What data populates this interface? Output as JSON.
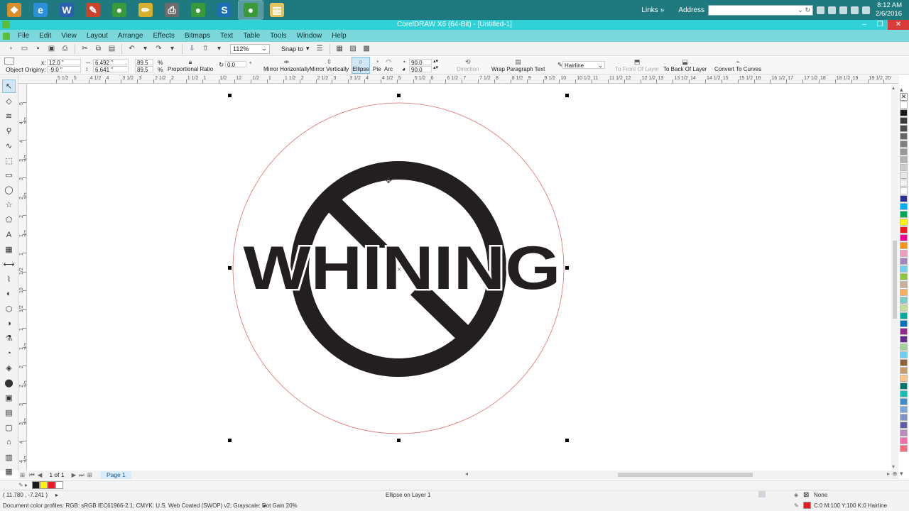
{
  "taskbar": {
    "apps": [
      {
        "name": "start",
        "glyph": "❖",
        "color": "#d98e2b"
      },
      {
        "name": "internet-explorer",
        "glyph": "e",
        "color": "#2b8fd9"
      },
      {
        "name": "word",
        "glyph": "W",
        "color": "#2b5fb0"
      },
      {
        "name": "coreldraw-graphics",
        "glyph": "✎",
        "color": "#c8452c"
      },
      {
        "name": "corel-app",
        "glyph": "●",
        "color": "#3a9a3a"
      },
      {
        "name": "corel-paint",
        "glyph": "✏",
        "color": "#d9b02b"
      },
      {
        "name": "printer",
        "glyph": "⎙",
        "color": "#6b6b6b"
      },
      {
        "name": "corel-app-2",
        "glyph": "●",
        "color": "#3a9a3a"
      },
      {
        "name": "s-app",
        "glyph": "S",
        "color": "#1b6fb5"
      },
      {
        "name": "coreldraw-active",
        "glyph": "●",
        "color": "#3a9a3a"
      },
      {
        "name": "file-explorer",
        "glyph": "▤",
        "color": "#e8c35a"
      }
    ],
    "links_label": "Links",
    "links_chevron": "»",
    "address_label": "Address",
    "address_value": "",
    "clock_time": "8:12 AM",
    "clock_date": "2/6/2016"
  },
  "window": {
    "title": "CorelDRAW X6 (64-Bit) - [Untitled-1]",
    "minimize": "–",
    "restore": "❐",
    "close": "✕"
  },
  "menu": [
    "File",
    "Edit",
    "View",
    "Layout",
    "Arrange",
    "Effects",
    "Bitmaps",
    "Text",
    "Table",
    "Tools",
    "Window",
    "Help"
  ],
  "std_toolbar": {
    "icons": [
      "new-icon",
      "open-icon",
      "save-icon",
      "save-all-icon",
      "print-icon",
      "cut-icon",
      "copy-icon",
      "paste-icon",
      "undo-icon",
      "redo-icon",
      "import-icon",
      "export-icon"
    ],
    "zoom": "112%",
    "snap_to": "Snap to"
  },
  "property_bar": {
    "object_origin": "Object Origin",
    "x_label": "x:",
    "x": "12.0 \"",
    "y_label": "y:",
    "y": "-9.0 \"",
    "w": "6.492 \"",
    "h": "6.641 \"",
    "scale_x": "89.5",
    "scale_y": "89.5",
    "percent": "%",
    "proportional_ratio": "Proportional Ratio",
    "rotation": "0.0",
    "degree": "°",
    "mirror_h": "Mirror Horizontally",
    "mirror_v": "Mirror Vertically",
    "ellipse": "Ellipse",
    "pie": "Pie",
    "arc": "Arc",
    "start_angle": "90.0",
    "end_angle": "90.0",
    "direction": "Direction",
    "wrap_text": "Wrap Paragraph Text",
    "outline": "Hairline",
    "to_front_of_layer": "To Front Of Layer",
    "to_back_of_layer": "To Back Of Layer",
    "convert_to_curves": "Convert To Curves"
  },
  "ruler": {
    "h_labels": [
      "5 1/2",
      "5",
      "4 1/2",
      "4",
      "3 1/2",
      "3",
      "2 1/2",
      "2",
      "1 1/2",
      "1",
      "1/2",
      "12",
      "1/2",
      "1",
      "1 1/2",
      "2",
      "2 1/2",
      "3",
      "3 1/2",
      "4",
      "4 1/2",
      "5",
      "5 1/2",
      "6",
      "6 1/2",
      "7",
      "7 1/2",
      "8",
      "8 1/2",
      "9",
      "9 1/2",
      "10",
      "10 1/2",
      "11",
      "11 1/2",
      "12",
      "12 1/2",
      "13",
      "13 1/2",
      "14",
      "14 1/2",
      "15",
      "15 1/2",
      "16",
      "16 1/2",
      "17",
      "17 1/2",
      "18",
      "18 1/2",
      "19",
      "19 1/2",
      "20",
      "20 1/2",
      "21",
      "21 1/2"
    ],
    "v_labels": [
      "5",
      "4 1/2",
      "4",
      "3 1/2",
      "3",
      "2 1/2",
      "2",
      "1 1/2",
      "1",
      "1/2",
      "10",
      "1/2",
      "1",
      "1 1/2",
      "2",
      "2 1/2",
      "3",
      "3 1/2",
      "4",
      "4 1/2",
      "5"
    ]
  },
  "toolbox": [
    "pick-tool-icon",
    "shape-tool-icon",
    "smear-tool-icon",
    "zoom-tool-icon",
    "freehand-tool-icon",
    "smart-fill-icon",
    "rectangle-tool-icon",
    "ellipse-tool-icon",
    "polygon-tool-icon",
    "basic-shapes-icon",
    "text-tool-icon",
    "table-tool-icon",
    "dimension-tool-icon",
    "connector-tool-icon",
    "blend-tool-icon",
    "extrude-tool-icon",
    "transparency-tool-icon",
    "eyedropper-tool-icon",
    "outline-tool-icon",
    "fill-tool-icon",
    "smart-fill-tool-icon",
    "docker-1-icon",
    "docker-2-icon",
    "docker-3-icon",
    "docker-4-icon",
    "docker-5-icon",
    "docker-6-icon",
    "docker-7-icon"
  ],
  "artwork": {
    "word": "WHINING",
    "ring_color": "#231f20",
    "selection_outline_color": "#e06a6a"
  },
  "palette": [
    "#ffffff",
    "#1a1a1a",
    "#3a3a3a",
    "#4d4d4d",
    "#666666",
    "#808080",
    "#999999",
    "#b3b3b3",
    "#cccccc",
    "#e6e6e6",
    "#f2f2f2",
    "#ffffff",
    "#2e3192",
    "#00aeef",
    "#00a651",
    "#fff200",
    "#ed1c24",
    "#ec008c",
    "#f7941d",
    "#f49ac1",
    "#a186be",
    "#6dcff6",
    "#8dc63f",
    "#c7b299",
    "#fbaf5d",
    "#7accc8",
    "#c4df9b",
    "#00a99d",
    "#0072bc",
    "#92278f",
    "#662d91",
    "#a3d39c",
    "#6ecff6",
    "#8c6239",
    "#c69c6d",
    "#fdc689",
    "#00746b",
    "#1cbbb4",
    "#438ccb",
    "#7da7d9",
    "#8393ca",
    "#605ca8",
    "#bd8cbf",
    "#f06eaa",
    "#f26d7d"
  ],
  "page_nav": {
    "first": "⏮",
    "prev": "◀",
    "count": "1 of 1",
    "next": "▶",
    "last": "⏭",
    "add": "⊞",
    "page_tab": "Page 1"
  },
  "doc_palette": [
    "#1a1a1a",
    "#fff200",
    "#ed1c24",
    "#ffffff"
  ],
  "status": {
    "coords": "( 11.780 , -7.241 )",
    "arrow": "▸",
    "object_info": "Ellipse on Layer 1",
    "color_profiles": "Document color profiles: RGB: sRGB IEC61966-2.1; CMYK: U.S. Web Coated (SWOP) v2; Grayscale: Dot Gain 20%",
    "fill_label": "None",
    "outline_info": "C:0 M:100 Y:100 K:0  Hairline",
    "outline_color": "#e02020"
  }
}
